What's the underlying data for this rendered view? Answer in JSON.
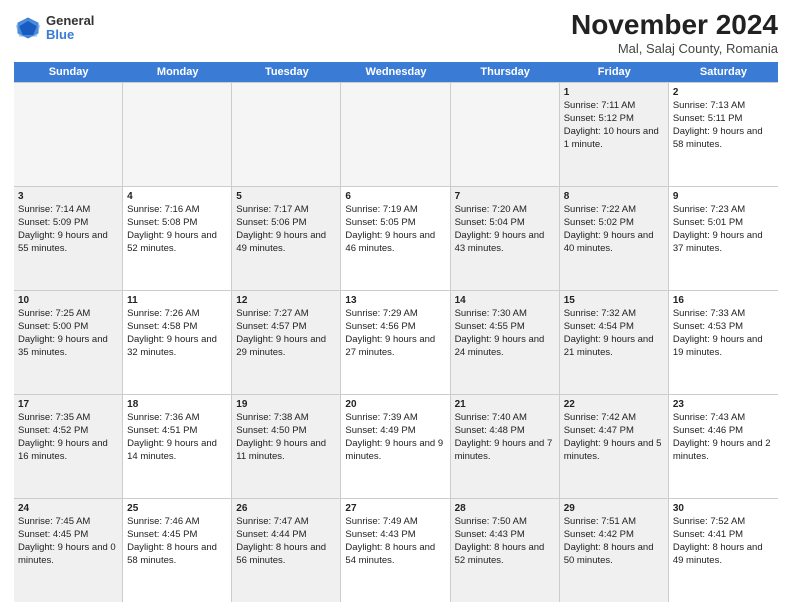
{
  "logo": {
    "general": "General",
    "blue": "Blue"
  },
  "header": {
    "month": "November 2024",
    "location": "Mal, Salaj County, Romania"
  },
  "weekdays": [
    "Sunday",
    "Monday",
    "Tuesday",
    "Wednesday",
    "Thursday",
    "Friday",
    "Saturday"
  ],
  "rows": [
    [
      {
        "day": "",
        "info": "",
        "empty": true
      },
      {
        "day": "",
        "info": "",
        "empty": true
      },
      {
        "day": "",
        "info": "",
        "empty": true
      },
      {
        "day": "",
        "info": "",
        "empty": true
      },
      {
        "day": "",
        "info": "",
        "empty": true
      },
      {
        "day": "1",
        "info": "Sunrise: 7:11 AM\nSunset: 5:12 PM\nDaylight: 10 hours and 1 minute.",
        "shaded": true
      },
      {
        "day": "2",
        "info": "Sunrise: 7:13 AM\nSunset: 5:11 PM\nDaylight: 9 hours and 58 minutes.",
        "shaded": false
      }
    ],
    [
      {
        "day": "3",
        "info": "Sunrise: 7:14 AM\nSunset: 5:09 PM\nDaylight: 9 hours and 55 minutes.",
        "shaded": true
      },
      {
        "day": "4",
        "info": "Sunrise: 7:16 AM\nSunset: 5:08 PM\nDaylight: 9 hours and 52 minutes."
      },
      {
        "day": "5",
        "info": "Sunrise: 7:17 AM\nSunset: 5:06 PM\nDaylight: 9 hours and 49 minutes.",
        "shaded": true
      },
      {
        "day": "6",
        "info": "Sunrise: 7:19 AM\nSunset: 5:05 PM\nDaylight: 9 hours and 46 minutes."
      },
      {
        "day": "7",
        "info": "Sunrise: 7:20 AM\nSunset: 5:04 PM\nDaylight: 9 hours and 43 minutes.",
        "shaded": true
      },
      {
        "day": "8",
        "info": "Sunrise: 7:22 AM\nSunset: 5:02 PM\nDaylight: 9 hours and 40 minutes.",
        "shaded": true
      },
      {
        "day": "9",
        "info": "Sunrise: 7:23 AM\nSunset: 5:01 PM\nDaylight: 9 hours and 37 minutes."
      }
    ],
    [
      {
        "day": "10",
        "info": "Sunrise: 7:25 AM\nSunset: 5:00 PM\nDaylight: 9 hours and 35 minutes.",
        "shaded": true
      },
      {
        "day": "11",
        "info": "Sunrise: 7:26 AM\nSunset: 4:58 PM\nDaylight: 9 hours and 32 minutes."
      },
      {
        "day": "12",
        "info": "Sunrise: 7:27 AM\nSunset: 4:57 PM\nDaylight: 9 hours and 29 minutes.",
        "shaded": true
      },
      {
        "day": "13",
        "info": "Sunrise: 7:29 AM\nSunset: 4:56 PM\nDaylight: 9 hours and 27 minutes."
      },
      {
        "day": "14",
        "info": "Sunrise: 7:30 AM\nSunset: 4:55 PM\nDaylight: 9 hours and 24 minutes.",
        "shaded": true
      },
      {
        "day": "15",
        "info": "Sunrise: 7:32 AM\nSunset: 4:54 PM\nDaylight: 9 hours and 21 minutes.",
        "shaded": true
      },
      {
        "day": "16",
        "info": "Sunrise: 7:33 AM\nSunset: 4:53 PM\nDaylight: 9 hours and 19 minutes."
      }
    ],
    [
      {
        "day": "17",
        "info": "Sunrise: 7:35 AM\nSunset: 4:52 PM\nDaylight: 9 hours and 16 minutes.",
        "shaded": true
      },
      {
        "day": "18",
        "info": "Sunrise: 7:36 AM\nSunset: 4:51 PM\nDaylight: 9 hours and 14 minutes."
      },
      {
        "day": "19",
        "info": "Sunrise: 7:38 AM\nSunset: 4:50 PM\nDaylight: 9 hours and 11 minutes.",
        "shaded": true
      },
      {
        "day": "20",
        "info": "Sunrise: 7:39 AM\nSunset: 4:49 PM\nDaylight: 9 hours and 9 minutes."
      },
      {
        "day": "21",
        "info": "Sunrise: 7:40 AM\nSunset: 4:48 PM\nDaylight: 9 hours and 7 minutes.",
        "shaded": true
      },
      {
        "day": "22",
        "info": "Sunrise: 7:42 AM\nSunset: 4:47 PM\nDaylight: 9 hours and 5 minutes.",
        "shaded": true
      },
      {
        "day": "23",
        "info": "Sunrise: 7:43 AM\nSunset: 4:46 PM\nDaylight: 9 hours and 2 minutes."
      }
    ],
    [
      {
        "day": "24",
        "info": "Sunrise: 7:45 AM\nSunset: 4:45 PM\nDaylight: 9 hours and 0 minutes.",
        "shaded": true
      },
      {
        "day": "25",
        "info": "Sunrise: 7:46 AM\nSunset: 4:45 PM\nDaylight: 8 hours and 58 minutes."
      },
      {
        "day": "26",
        "info": "Sunrise: 7:47 AM\nSunset: 4:44 PM\nDaylight: 8 hours and 56 minutes.",
        "shaded": true
      },
      {
        "day": "27",
        "info": "Sunrise: 7:49 AM\nSunset: 4:43 PM\nDaylight: 8 hours and 54 minutes."
      },
      {
        "day": "28",
        "info": "Sunrise: 7:50 AM\nSunset: 4:43 PM\nDaylight: 8 hours and 52 minutes.",
        "shaded": true
      },
      {
        "day": "29",
        "info": "Sunrise: 7:51 AM\nSunset: 4:42 PM\nDaylight: 8 hours and 50 minutes.",
        "shaded": true
      },
      {
        "day": "30",
        "info": "Sunrise: 7:52 AM\nSunset: 4:41 PM\nDaylight: 8 hours and 49 minutes."
      }
    ]
  ]
}
